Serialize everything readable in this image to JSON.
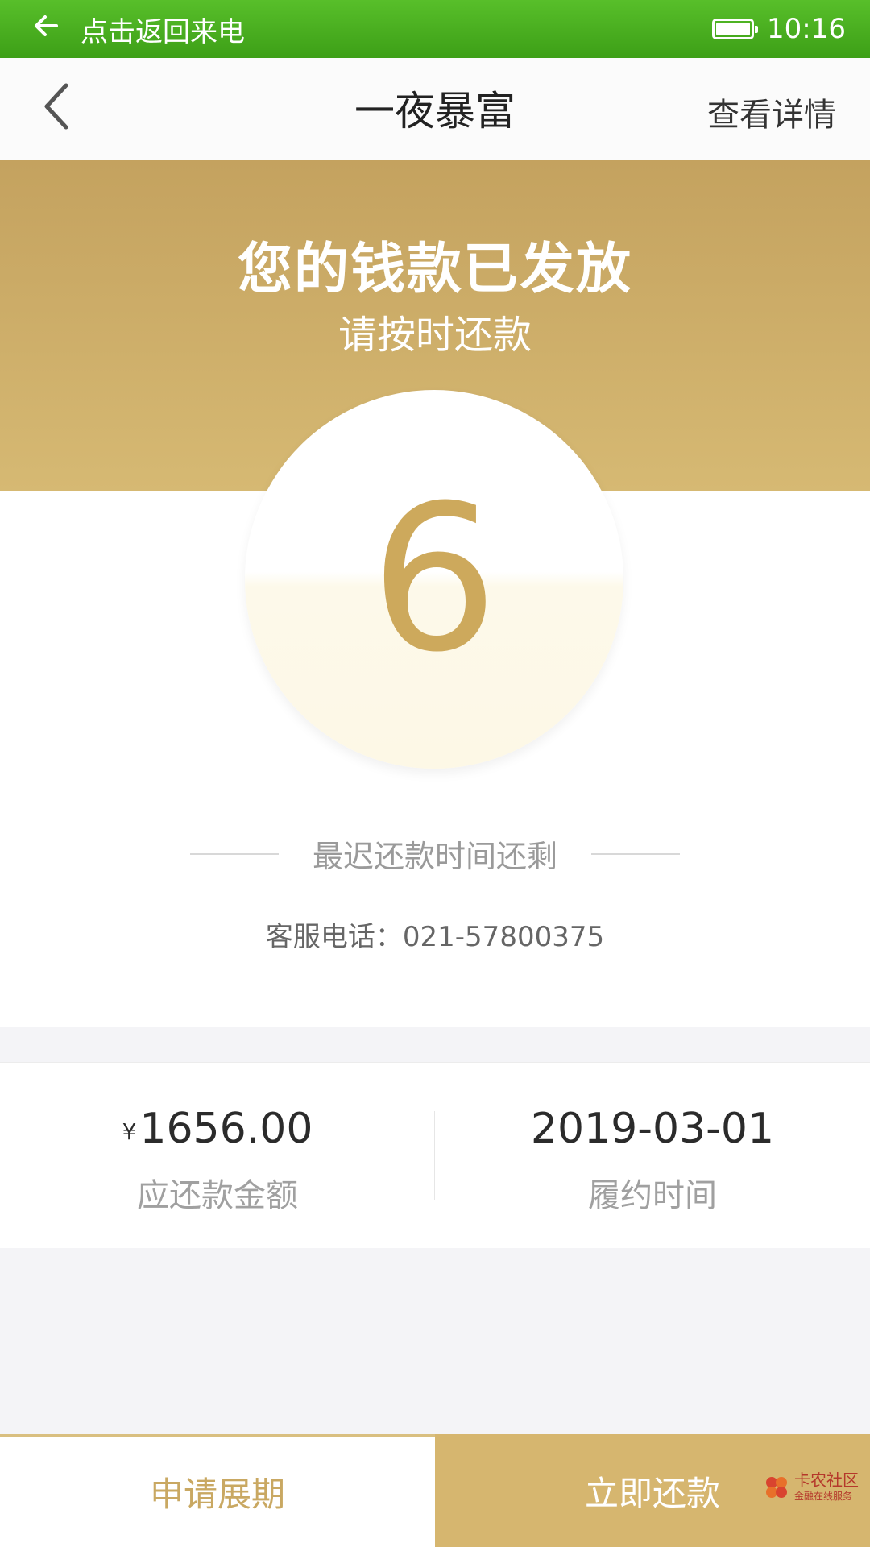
{
  "status_bar": {
    "back_icon": "arrow-left-icon",
    "return_call_text": "点击返回来电",
    "battery_icon": "battery-icon",
    "time": "10:16"
  },
  "nav": {
    "back_icon": "chevron-left-icon",
    "title": "一夜暴富",
    "details_label": "查看详情"
  },
  "header": {
    "headline": "您的钱款已发放",
    "subline": "请按时还款"
  },
  "countdown": {
    "days_remaining": "6",
    "deadline_caption": "最迟还款时间还剩"
  },
  "service": {
    "phone_text": "客服电话：021-57800375"
  },
  "info": {
    "amount": {
      "currency": "¥",
      "value": "1656.00",
      "label": "应还款金额"
    },
    "date": {
      "value": "2019-03-01",
      "label": "履约时间"
    }
  },
  "buttons": {
    "extend_label": "申请展期",
    "repay_label": "立即还款"
  },
  "watermark": {
    "text": "卡农社区",
    "subtext": "金融在线服务",
    "logo_icon": "kanong-logo-icon"
  },
  "colors": {
    "status_green": "#4caf22",
    "gold": "#cda95c",
    "gold_light": "#d6b66f"
  }
}
